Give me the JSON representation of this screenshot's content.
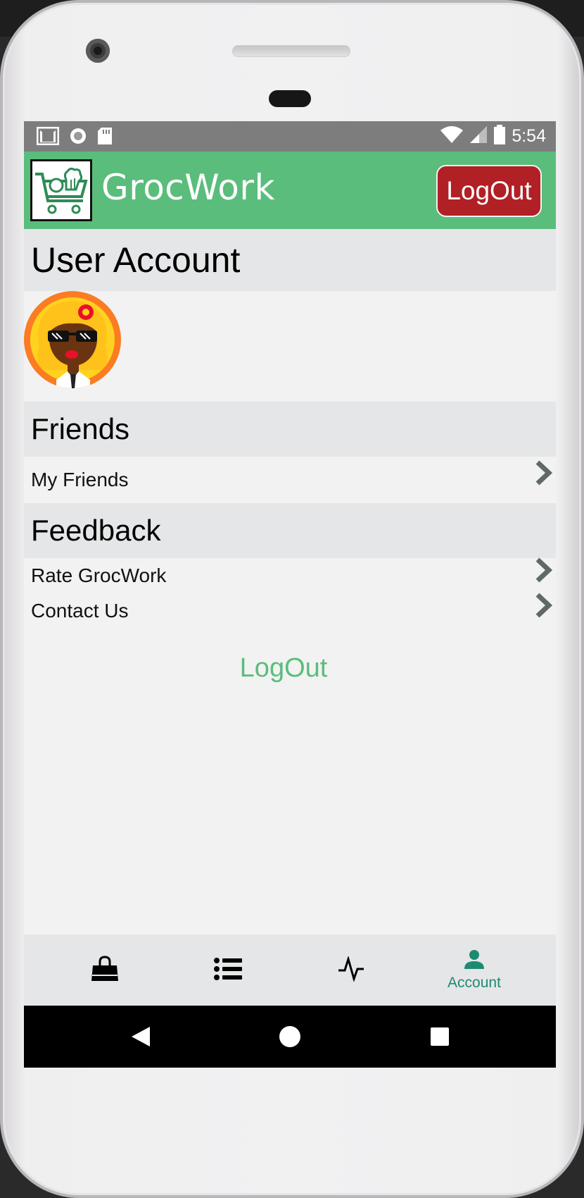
{
  "status_bar": {
    "time": "5:54",
    "left_icons": [
      "gmail-icon",
      "circle-icon",
      "sd-card-icon"
    ],
    "right_icons": [
      "wifi-icon",
      "cell-signal-icon",
      "battery-icon"
    ]
  },
  "app_bar": {
    "title": "GrocWork",
    "logout_button": "LogOut",
    "logo_icon": "cart-logo-icon",
    "brand_color": "#5abd7c",
    "logout_color": "#b02025"
  },
  "account": {
    "heading": "User Account",
    "avatar_icon": "user-avatar"
  },
  "friends": {
    "heading": "Friends",
    "items": [
      {
        "label": "My Friends"
      }
    ]
  },
  "feedback": {
    "heading": "Feedback",
    "items": [
      {
        "label": "Rate GrocWork"
      },
      {
        "label": "Contact Us"
      }
    ]
  },
  "logout_link": "LogOut",
  "bottom_nav": {
    "items": [
      {
        "icon": "shopping-bag-icon",
        "label": ""
      },
      {
        "icon": "list-icon",
        "label": ""
      },
      {
        "icon": "activity-icon",
        "label": ""
      },
      {
        "icon": "person-icon",
        "label": "Account",
        "active": true
      }
    ],
    "active_color": "#1f8a72"
  },
  "system_nav": [
    "back-icon",
    "home-icon",
    "recents-icon"
  ]
}
